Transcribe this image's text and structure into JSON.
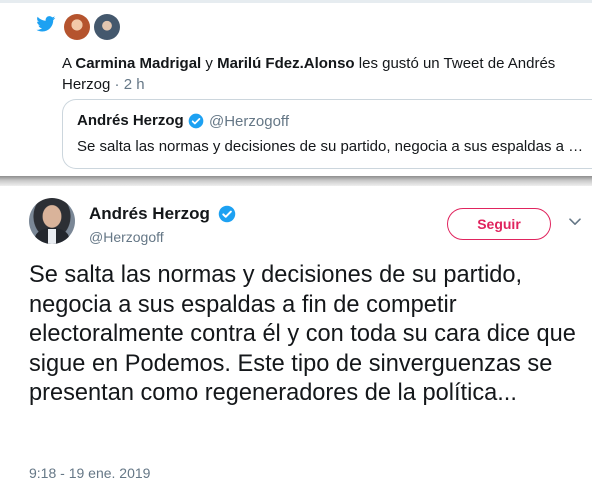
{
  "notification": {
    "prefix": "A",
    "user1": "Carmina Madrigal",
    "conj": "y",
    "user2": "Marilú Fdez.Alonso",
    "action": "les gustó un Tweet de Andrés Herzog",
    "time": "· 2 h"
  },
  "quoted_tweet": {
    "name": "Andrés Herzog",
    "handle": "@Herzogoff",
    "text": "Se salta las normas y decisiones de su partido, negocia a sus espaldas a …"
  },
  "tweet": {
    "name": "Andrés Herzog",
    "handle": "@Herzogoff",
    "follow_label": "Seguir",
    "text": "Se salta las normas y decisiones de su partido, negocia a sus espaldas a fin de competir electoralmente contra él y con toda su cara dice que sigue en Podemos. Este tipo de sinverguenzas se presentan como regeneradores de la política...",
    "timestamp": "9:18 - 19 ene. 2019"
  },
  "icons": {
    "notification": "twitter-bird-icon",
    "verified": "verified-badge-icon",
    "menu": "chevron-down-icon"
  },
  "colors": {
    "twitter_blue": "#1da1f2",
    "follow_red": "#e0245e",
    "secondary_text": "#657786"
  }
}
